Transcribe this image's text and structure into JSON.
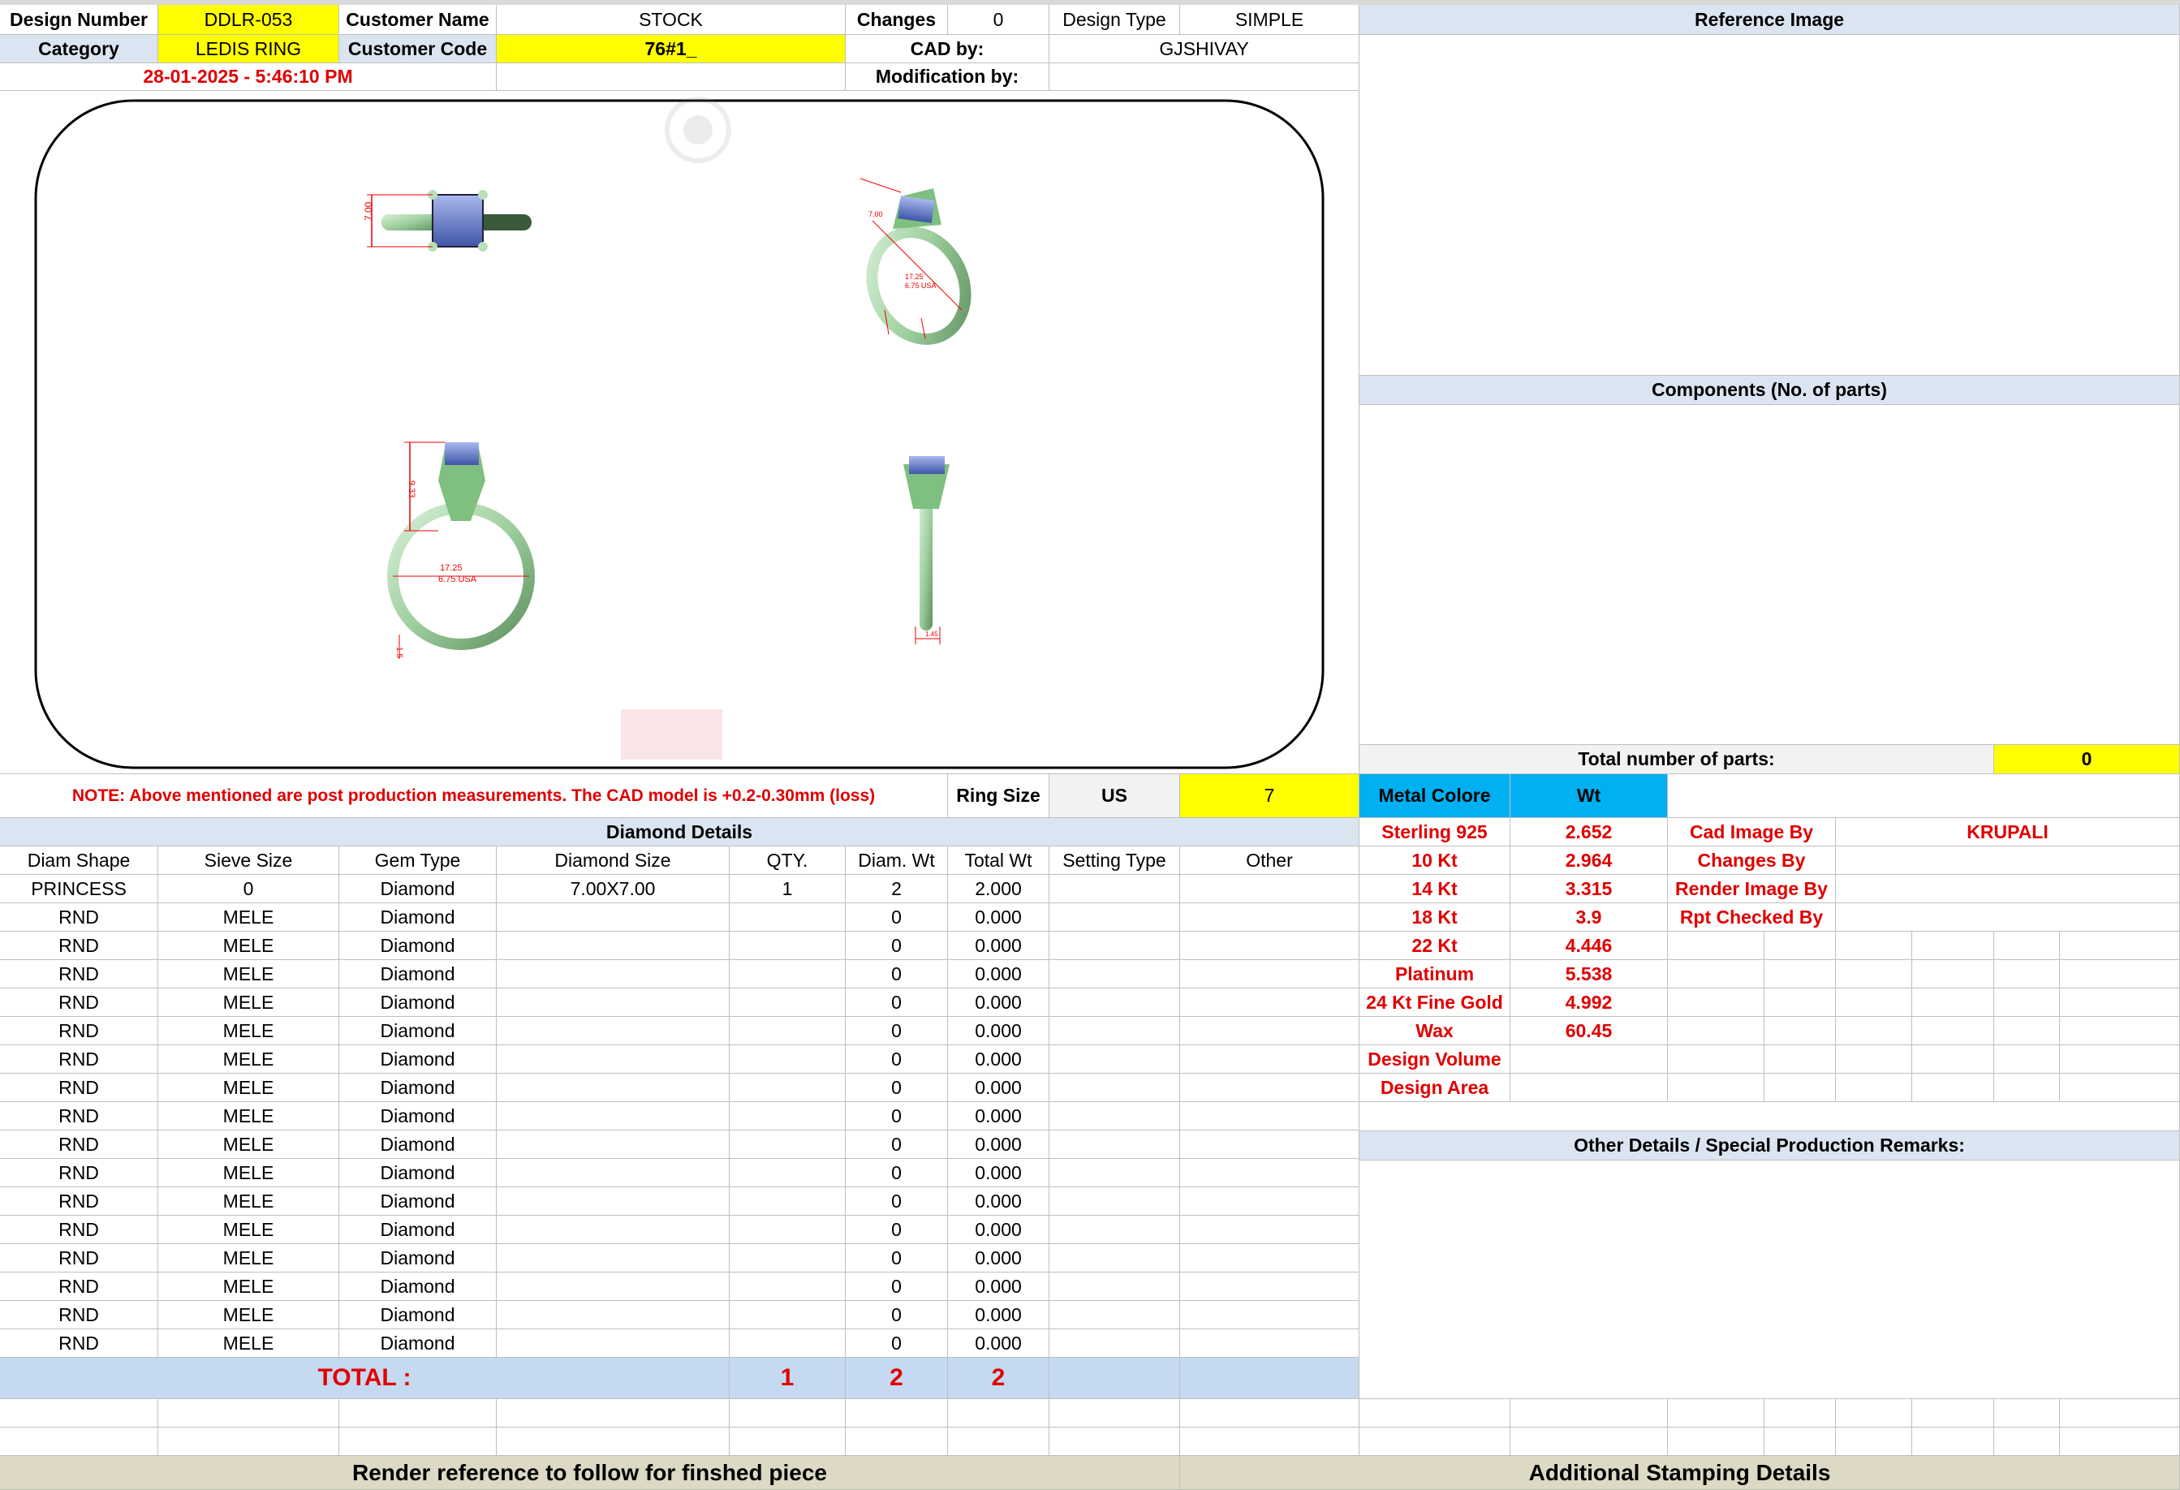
{
  "header": {
    "design_number_label": "Design Number",
    "design_number": "DDLR-053",
    "customer_name_label": "Customer Name",
    "customer_name": "STOCK",
    "changes_label": "Changes",
    "changes_value": "0",
    "design_type_label": "Design Type",
    "design_type": "SIMPLE",
    "reference_image_label": "Reference Image",
    "category_label": "Category",
    "category": "LEDIS RING",
    "customer_code_label": "Customer Code",
    "customer_code": "76#1_",
    "cad_by_label": "CAD by:",
    "cad_by": "GJSHIVAY",
    "datetime": "28-01-2025 - 5:46:10 PM",
    "modification_by_label": "Modification by:",
    "modification_by": ""
  },
  "drawing": {
    "top_dim": "7.00",
    "persp_dim_1": "7.00",
    "persp_dim_2": "17.25",
    "persp_dim_3": "6.75 USA",
    "front_height": "9.33",
    "front_inner": "17.25",
    "front_size": "6.75 USA",
    "front_shank": "1.5",
    "side_width": "1.45"
  },
  "right_panel": {
    "components_label": "Components (No. of parts)",
    "total_parts_label": "Total number of parts:",
    "total_parts": "0"
  },
  "note": {
    "text": "NOTE: Above mentioned are post production measurements. The CAD model is +0.2-0.30mm (loss)",
    "ring_size_label": "Ring Size",
    "ring_size_unit": "US",
    "ring_size_value": "7"
  },
  "diamond": {
    "title": "Diamond Details",
    "headers": [
      "Diam Shape",
      "Sieve Size",
      "Gem Type",
      "Diamond Size",
      "QTY.",
      "Diam. Wt",
      "Total Wt",
      "Setting Type",
      "Other"
    ],
    "rows": [
      [
        "PRINCESS",
        "0",
        "Diamond",
        "7.00X7.00",
        "1",
        "2",
        "2.000",
        "",
        ""
      ],
      [
        "RND",
        "MELE",
        "Diamond",
        "",
        "",
        "0",
        "0.000",
        "",
        ""
      ],
      [
        "RND",
        "MELE",
        "Diamond",
        "",
        "",
        "0",
        "0.000",
        "",
        ""
      ],
      [
        "RND",
        "MELE",
        "Diamond",
        "",
        "",
        "0",
        "0.000",
        "",
        ""
      ],
      [
        "RND",
        "MELE",
        "Diamond",
        "",
        "",
        "0",
        "0.000",
        "",
        ""
      ],
      [
        "RND",
        "MELE",
        "Diamond",
        "",
        "",
        "0",
        "0.000",
        "",
        ""
      ],
      [
        "RND",
        "MELE",
        "Diamond",
        "",
        "",
        "0",
        "0.000",
        "",
        ""
      ],
      [
        "RND",
        "MELE",
        "Diamond",
        "",
        "",
        "0",
        "0.000",
        "",
        ""
      ],
      [
        "RND",
        "MELE",
        "Diamond",
        "",
        "",
        "0",
        "0.000",
        "",
        ""
      ],
      [
        "RND",
        "MELE",
        "Diamond",
        "",
        "",
        "0",
        "0.000",
        "",
        ""
      ],
      [
        "RND",
        "MELE",
        "Diamond",
        "",
        "",
        "0",
        "0.000",
        "",
        ""
      ],
      [
        "RND",
        "MELE",
        "Diamond",
        "",
        "",
        "0",
        "0.000",
        "",
        ""
      ],
      [
        "RND",
        "MELE",
        "Diamond",
        "",
        "",
        "0",
        "0.000",
        "",
        ""
      ],
      [
        "RND",
        "MELE",
        "Diamond",
        "",
        "",
        "0",
        "0.000",
        "",
        ""
      ],
      [
        "RND",
        "MELE",
        "Diamond",
        "",
        "",
        "0",
        "0.000",
        "",
        ""
      ],
      [
        "RND",
        "MELE",
        "Diamond",
        "",
        "",
        "0",
        "0.000",
        "",
        ""
      ],
      [
        "RND",
        "MELE",
        "Diamond",
        "",
        "",
        "0",
        "0.000",
        "",
        ""
      ]
    ],
    "total_label": "TOTAL :",
    "total_qty": "1",
    "total_diam_wt": "2",
    "total_wt": "2"
  },
  "metal": {
    "header_label": "Metal Colore",
    "wt_label": "Wt",
    "rows": [
      {
        "name": "Sterling 925",
        "wt": "2.652"
      },
      {
        "name": "10 Kt",
        "wt": "2.964"
      },
      {
        "name": "14 Kt",
        "wt": "3.315"
      },
      {
        "name": "18 Kt",
        "wt": "3.9"
      },
      {
        "name": "22 Kt",
        "wt": "4.446"
      },
      {
        "name": "Platinum",
        "wt": "5.538"
      },
      {
        "name": "24 Kt Fine Gold",
        "wt": "4.992"
      },
      {
        "name": "Wax",
        "wt": "60.45"
      },
      {
        "name": "Design Volume",
        "wt": ""
      },
      {
        "name": "Design Area",
        "wt": ""
      }
    ]
  },
  "staff": [
    {
      "label": "Cad Image By",
      "value": "KRUPALI"
    },
    {
      "label": "Changes By",
      "value": ""
    },
    {
      "label": "Render Image By",
      "value": ""
    },
    {
      "label": "Rpt Checked By",
      "value": ""
    }
  ],
  "remarks": {
    "label": "Other Details / Special Production Remarks:"
  },
  "footer": {
    "left": "Render reference to follow for finshed piece",
    "right": "Additional Stamping Details"
  },
  "colors": {
    "yellow": "#ffff00",
    "header_blue": "#dbe5f1",
    "metal_cyan": "#00b0f0",
    "red_text": "#e00000",
    "footer_tan": "#ddd9c4",
    "total_blue": "#c5d9f1",
    "ring_green": "#a8d9a8",
    "stone_blue": "#5b78c8"
  }
}
